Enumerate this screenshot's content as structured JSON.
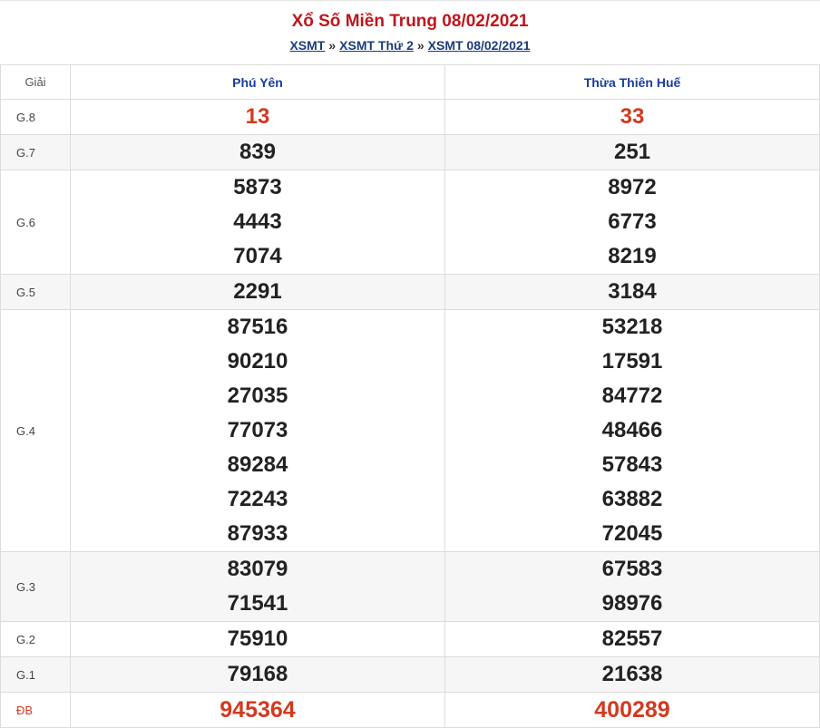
{
  "header": {
    "title": "Xổ Số Miền Trung 08/02/2021",
    "breadcrumb": [
      "XSMT",
      "XSMT Thứ 2",
      "XSMT 08/02/2021"
    ],
    "separator": "»"
  },
  "table": {
    "label_header": "Giải",
    "provinces": [
      "Phú Yên",
      "Thừa Thiên Huế"
    ],
    "prizes": [
      {
        "label": "G.8",
        "highlight": true,
        "cols": [
          [
            "13"
          ],
          [
            "33"
          ]
        ]
      },
      {
        "label": "G.7",
        "cols": [
          [
            "839"
          ],
          [
            "251"
          ]
        ]
      },
      {
        "label": "G.6",
        "cols": [
          [
            "5873",
            "4443",
            "7074"
          ],
          [
            "8972",
            "6773",
            "8219"
          ]
        ]
      },
      {
        "label": "G.5",
        "cols": [
          [
            "2291"
          ],
          [
            "3184"
          ]
        ]
      },
      {
        "label": "G.4",
        "cols": [
          [
            "87516",
            "90210",
            "27035",
            "77073",
            "89284",
            "72243",
            "87933"
          ],
          [
            "53218",
            "17591",
            "84772",
            "48466",
            "57843",
            "63882",
            "72045"
          ]
        ]
      },
      {
        "label": "G.3",
        "cols": [
          [
            "83079",
            "71541"
          ],
          [
            "67583",
            "98976"
          ]
        ]
      },
      {
        "label": "G.2",
        "cols": [
          [
            "75910"
          ],
          [
            "82557"
          ]
        ]
      },
      {
        "label": "G.1",
        "cols": [
          [
            "79168"
          ],
          [
            "21638"
          ]
        ]
      },
      {
        "label": "ĐB",
        "highlight": true,
        "special": true,
        "cols": [
          [
            "945364"
          ],
          [
            "400289"
          ]
        ]
      }
    ]
  },
  "colors": {
    "title": "#c0161b",
    "highlight_number": "#d23a1e",
    "province": "#1a3d9c",
    "link": "#1a3d7a"
  }
}
